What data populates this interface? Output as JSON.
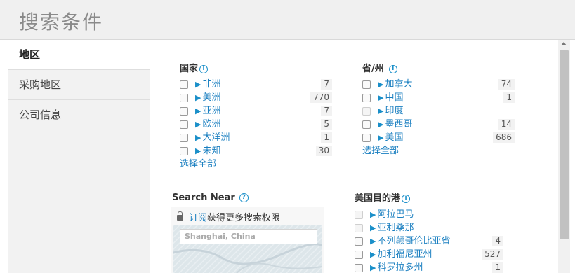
{
  "header": {
    "title": "搜索条件"
  },
  "sidebar": {
    "items": [
      {
        "label": "地区",
        "active": true
      },
      {
        "label": "采购地区",
        "active": false
      },
      {
        "label": "公司信息",
        "active": false
      }
    ]
  },
  "country": {
    "title": "国家",
    "items": [
      {
        "label": "非洲",
        "count": "7"
      },
      {
        "label": "美洲",
        "count": "770"
      },
      {
        "label": "亚洲",
        "count": "7"
      },
      {
        "label": "欧洲",
        "count": "5"
      },
      {
        "label": "大洋洲",
        "count": "1"
      },
      {
        "label": "未知",
        "count": "30"
      }
    ],
    "select_all": "选择全部"
  },
  "province": {
    "title": "省/州",
    "items": [
      {
        "label": "加拿大",
        "count": "74"
      },
      {
        "label": "中国",
        "count": "1"
      },
      {
        "label": "印度",
        "count": ""
      },
      {
        "label": "墨西哥",
        "count": "14"
      },
      {
        "label": "美国",
        "count": "686"
      }
    ],
    "select_all": "选择全部"
  },
  "search_near": {
    "title": "Search Near",
    "subscribe_link": "订阅",
    "subscribe_text": "获得更多搜索权限",
    "placeholder": "Shanghai, China"
  },
  "us_ports": {
    "title": "美国目的港",
    "items": [
      {
        "label": "阿拉巴马",
        "count": ""
      },
      {
        "label": "亚利桑那",
        "count": ""
      },
      {
        "label": "不列颠哥伦比亚省",
        "count": "4"
      },
      {
        "label": "加利福尼亚州",
        "count": "527"
      },
      {
        "label": "科罗拉多州",
        "count": "1"
      }
    ]
  },
  "colors": {
    "accent": "#1a7fc0",
    "header_bg": "#f0f0f0",
    "sidebar_bg": "#f2f2f2"
  }
}
